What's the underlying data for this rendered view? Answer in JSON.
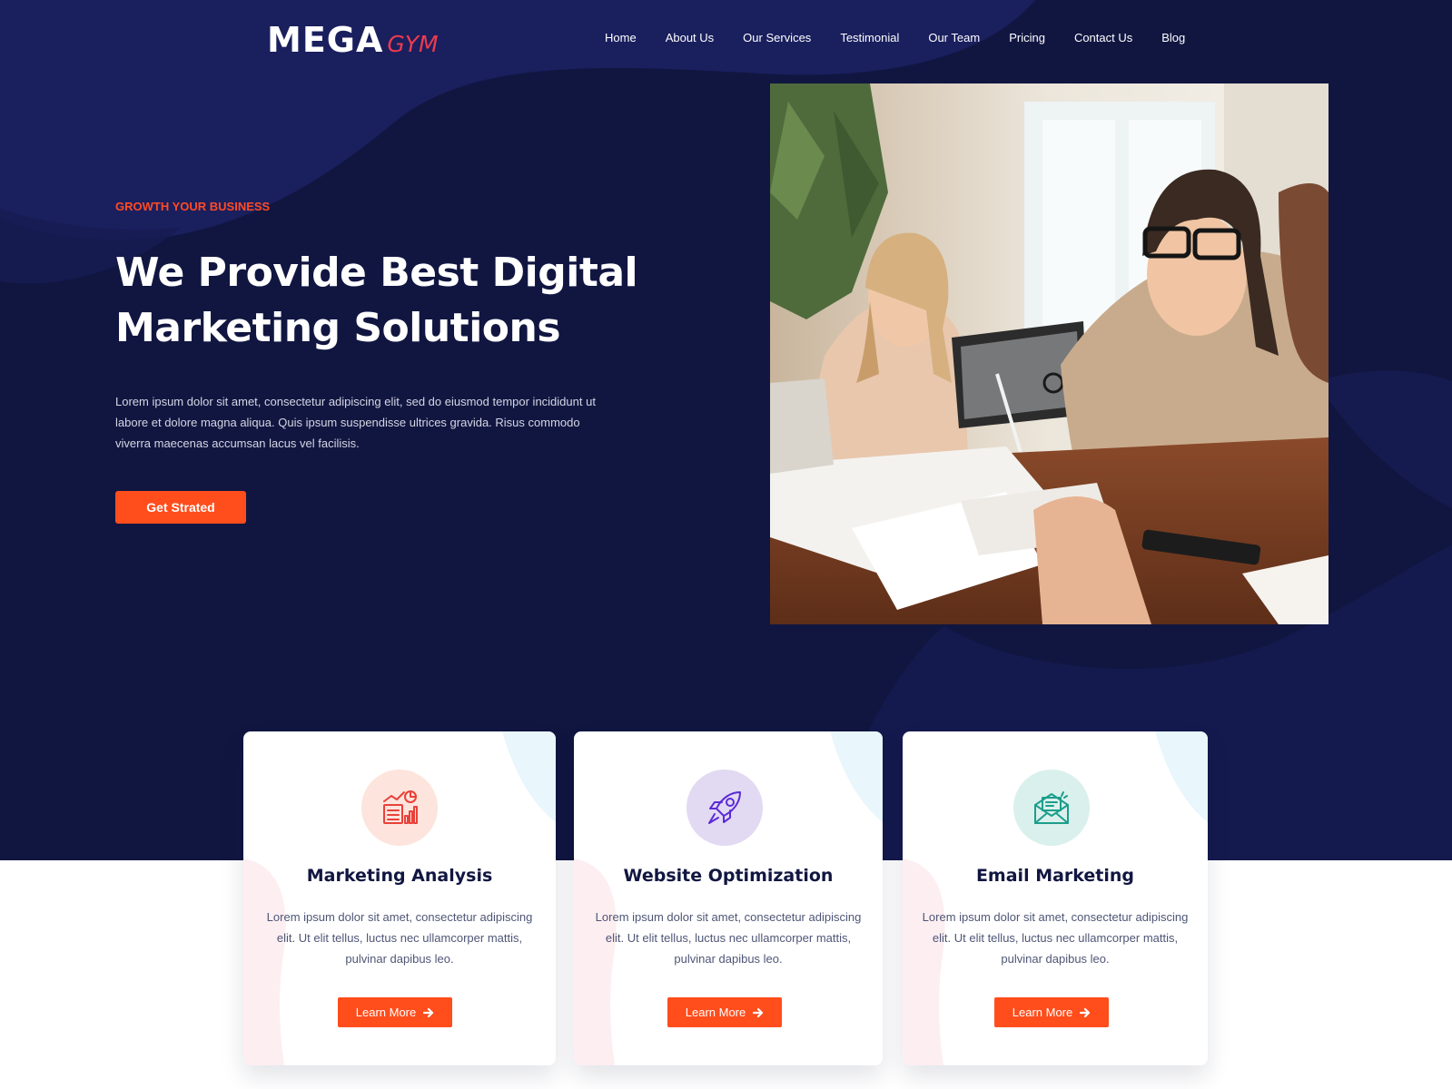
{
  "brand": {
    "main": "MEGA",
    "sub": "GYM"
  },
  "nav": {
    "items": [
      {
        "label": "Home"
      },
      {
        "label": "About Us"
      },
      {
        "label": "Our Services"
      },
      {
        "label": "Testimonial"
      },
      {
        "label": "Our Team"
      },
      {
        "label": "Pricing"
      },
      {
        "label": "Contact Us"
      },
      {
        "label": "Blog"
      }
    ]
  },
  "hero": {
    "eyebrow": "GROWTH YOUR BUSINESS",
    "title_line1": "We Provide Best Digital",
    "title_line2": "Marketing Solutions",
    "description": "Lorem ipsum dolor sit amet, consectetur adipiscing elit, sed do eiusmod tempor incididunt ut labore et dolore magna aliqua. Quis ipsum suspendisse ultrices gravida. Risus commodo viverra maecenas accumsan lacus vel facilisis.",
    "cta_label": "Get Strated"
  },
  "services": [
    {
      "title": "Marketing Analysis",
      "text": "Lorem ipsum dolor sit amet, consectetur adipiscing elit. Ut elit tellus, luctus nec ullamcorper mattis, pulvinar dapibus leo.",
      "button": "Learn More",
      "icon": "analytics-chart-icon",
      "icon_bg": "#fde4dc",
      "icon_color": "#e8413a"
    },
    {
      "title": "Website Optimization",
      "text": "Lorem ipsum dolor sit amet, consectetur adipiscing elit. Ut elit tellus, luctus nec ullamcorper mattis, pulvinar dapibus leo.",
      "button": "Learn More",
      "icon": "rocket-icon",
      "icon_bg": "#e2d9f2",
      "icon_color": "#5b2bd6"
    },
    {
      "title": "Email Marketing",
      "text": "Lorem ipsum dolor sit amet, consectetur adipiscing elit. Ut elit tellus, luctus nec ullamcorper mattis, pulvinar dapibus leo.",
      "button": "Learn More",
      "icon": "email-envelope-icon",
      "icon_bg": "#daf0ec",
      "icon_color": "#1c9e8c"
    }
  ],
  "colors": {
    "navy": "#111641",
    "accent": "#ff4d1c",
    "eyebrow": "#ff4b25",
    "logo_accent": "#ef3a4f"
  }
}
